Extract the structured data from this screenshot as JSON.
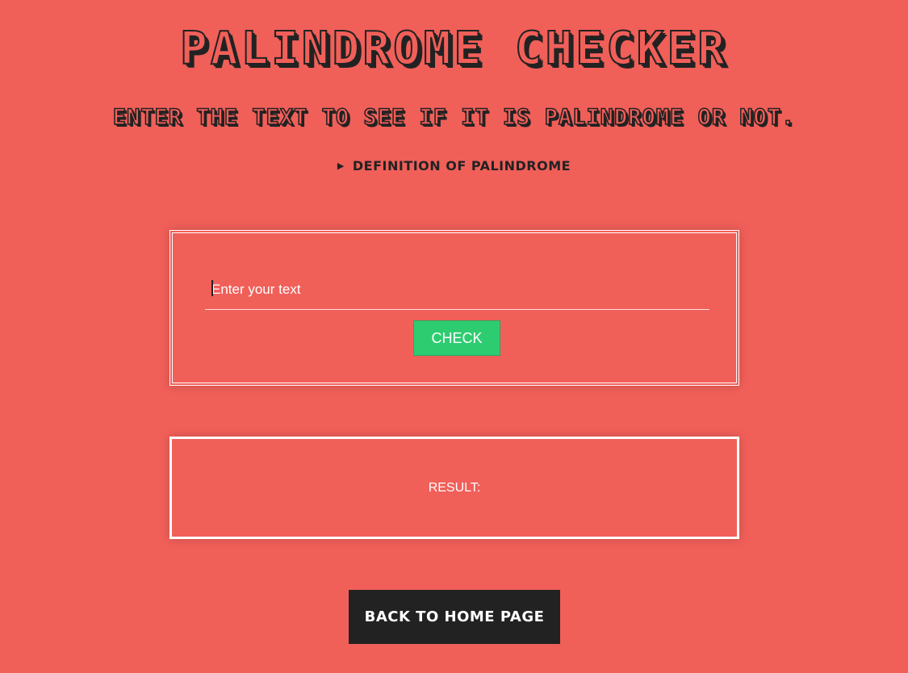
{
  "header": {
    "title": "PALINDROME CHECKER",
    "subtitle": "ENTER THE TEXT TO SEE IF IT IS PALINDROME OR NOT."
  },
  "definition": {
    "label": "DEFINITION OF PALINDROME"
  },
  "form": {
    "input_value": "",
    "input_placeholder": "Enter your text",
    "check_label": "CHECK"
  },
  "result": {
    "label": "RESULT:"
  },
  "footer": {
    "home_label": "BACK TO HOME PAGE"
  },
  "colors": {
    "background": "#f15f59",
    "check_button": "#2ecc71",
    "home_button": "#222222",
    "text_dark": "#222222"
  },
  "icons": {
    "disclosure": "disclosure-triangle-icon"
  }
}
